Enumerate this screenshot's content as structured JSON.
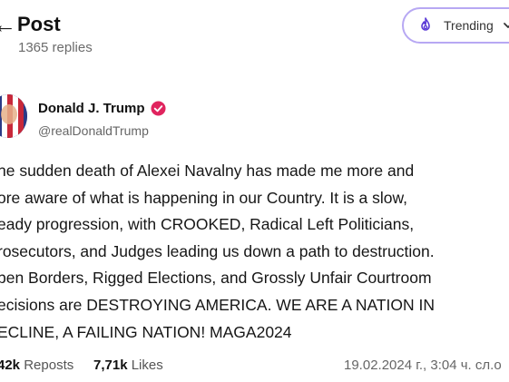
{
  "header": {
    "title": "Post",
    "replies": "1365 replies",
    "trend_label": "Trending"
  },
  "author": {
    "name": "Donald J. Trump",
    "handle": "@realDonaldTrump"
  },
  "post": {
    "lines": [
      "he sudden death of Alexei Navalny has made me more and",
      "ore aware of what is happening in our Country. It is a slow,",
      "eady progression, with CROOKED, Radical Left Politicians,",
      "rosecutors, and Judges leading us down a path to destruction.",
      "pen Borders, Rigged Elections, and Grossly Unfair Courtroom",
      "ecisions are DESTROYING AMERICA. WE ARE A NATION IN",
      "ECLINE, A FAILING NATION! MAGA2024"
    ]
  },
  "stats": {
    "reposts_count": "42k",
    "reposts_label": "Reposts",
    "likes_count": "7,71k",
    "likes_label": "Likes",
    "timestamp": "19.02.2024 г., 3:04 ч. сл.о"
  },
  "colors": {
    "pill_border": "#b7a8f3",
    "badge": "#e0245e",
    "accent": "#7c5cff"
  }
}
